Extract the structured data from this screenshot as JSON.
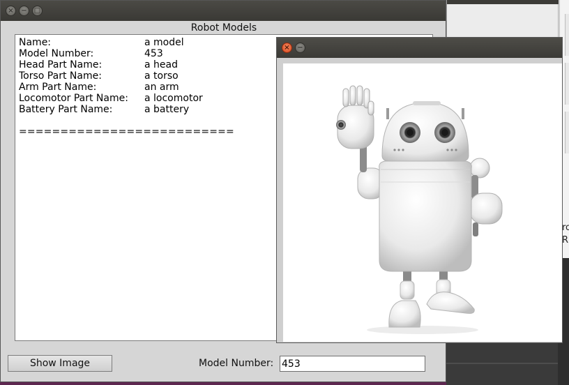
{
  "main_window": {
    "title": "Robot Models",
    "buttons": {
      "close": "×",
      "minimize": "−",
      "maximize": "□"
    },
    "fields": [
      {
        "label": "Name:",
        "value": "a model"
      },
      {
        "label": "Model Number:",
        "value": "453"
      },
      {
        "label": "Head Part Name:",
        "value": "a head"
      },
      {
        "label": "Torso Part Name:",
        "value": "a torso"
      },
      {
        "label": "Arm Part Name:",
        "value": "an arm"
      },
      {
        "label": "Locomotor Part Name:",
        "value": "a locomotor"
      },
      {
        "label": "Battery Part Name:",
        "value": "a battery"
      }
    ],
    "separator": "==========================",
    "show_image_label": "Show Image",
    "model_number_label": "Model Number:",
    "model_number_value": "453"
  },
  "image_window": {
    "buttons": {
      "close": "×",
      "minimize": "−"
    },
    "image_subject": "robot-illustration"
  },
  "background": {
    "edge_text": "ro\nR"
  },
  "colors": {
    "titlebar": "#3c3b37",
    "close_button": "#e4582a",
    "window_bg": "#d6d6d6",
    "purple_bar": "#5e2750"
  }
}
